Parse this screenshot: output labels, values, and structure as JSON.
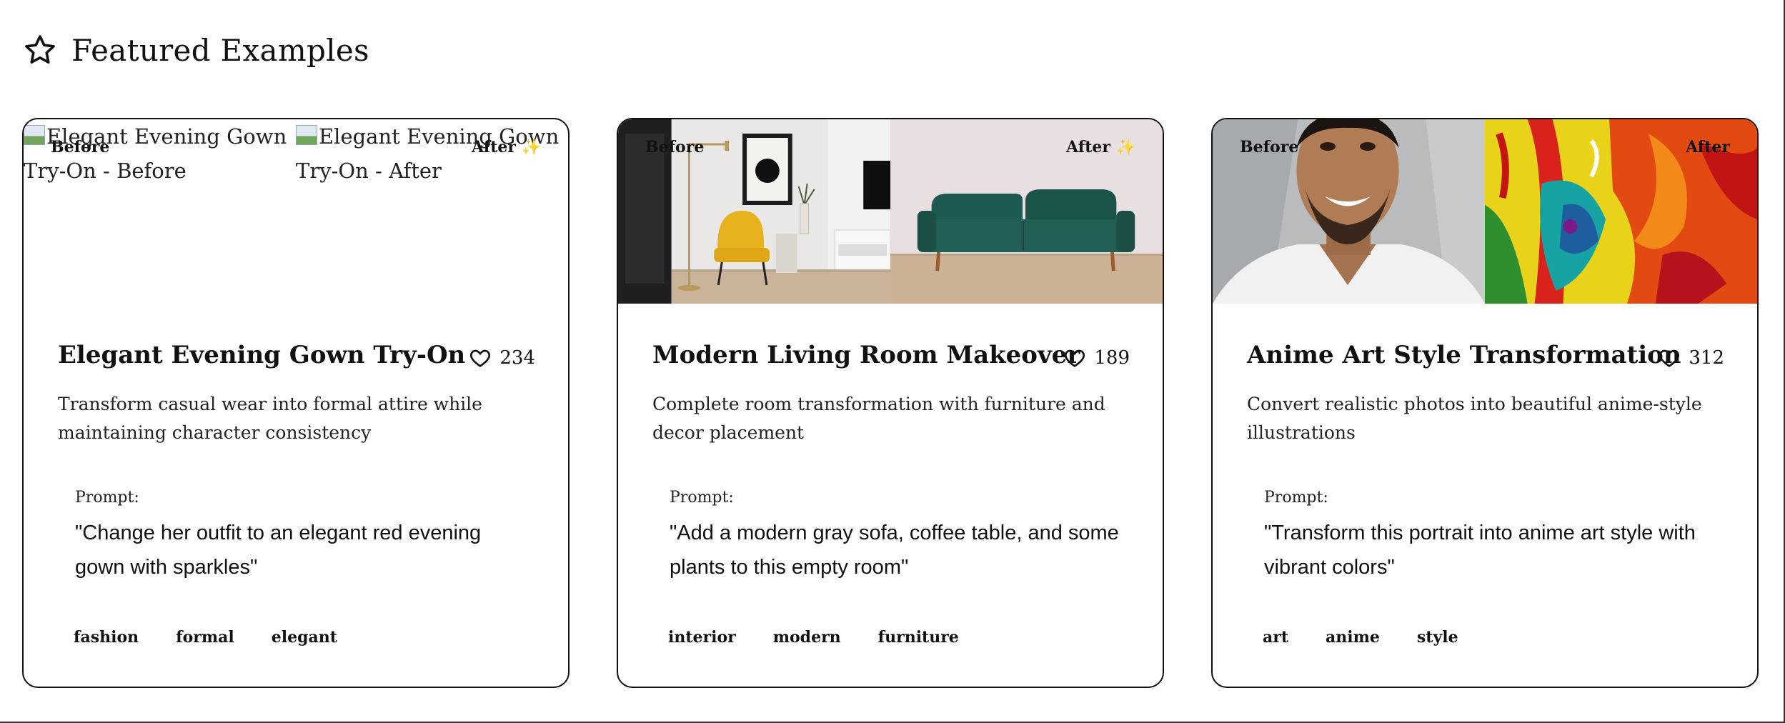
{
  "section": {
    "title": "Featured Examples",
    "icon": "star-icon"
  },
  "cards": [
    {
      "title": "Elegant Evening Gown Try-On",
      "likes": "234",
      "description": "Transform casual wear into formal attire while maintaining character consistency",
      "before_label": "Before",
      "after_label": "After ✨",
      "before_alt": "Elegant Evening Gown Try-On - Before",
      "after_alt": "Elegant Evening Gown Try-On - After",
      "prompt_label": "Prompt:",
      "prompt": "\"Change her outfit to an elegant red evening gown with sparkles\"",
      "tags": [
        "fashion",
        "formal",
        "elegant"
      ]
    },
    {
      "title": "Modern Living Room Makeover",
      "likes": "189",
      "description": "Complete room transformation with furniture and decor placement",
      "before_label": "Before",
      "after_label": "After ✨",
      "prompt_label": "Prompt:",
      "prompt": "\"Add a modern gray sofa, coffee table, and some plants to this empty room\"",
      "tags": [
        "interior",
        "modern",
        "furniture"
      ]
    },
    {
      "title": "Anime Art Style Transformation",
      "likes": "312",
      "description": "Convert realistic photos into beautiful anime-style illustrations",
      "before_label": "Before",
      "after_label": "After",
      "prompt_label": "Prompt:",
      "prompt": "\"Transform this portrait into anime art style with vibrant colors\"",
      "tags": [
        "art",
        "anime",
        "style"
      ]
    }
  ],
  "colors": {
    "text": "#111111",
    "border": "#111111",
    "background": "#ffffff",
    "sofa": "#1f5a52",
    "chair": "#e8b21f"
  }
}
